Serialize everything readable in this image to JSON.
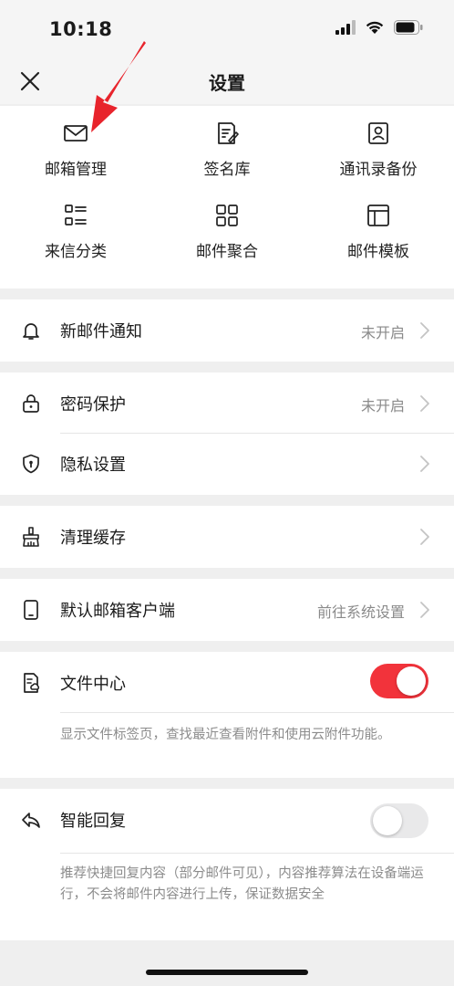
{
  "status_bar": {
    "time": "10:18",
    "icons": [
      "signal-icon",
      "wifi-icon",
      "battery-icon"
    ]
  },
  "nav": {
    "title": "设置",
    "close_icon": "close-icon"
  },
  "grid": {
    "items": [
      {
        "label": "邮箱管理",
        "icon": "mail-icon"
      },
      {
        "label": "签名库",
        "icon": "signature-icon"
      },
      {
        "label": "通讯录备份",
        "icon": "contacts-icon"
      },
      {
        "label": "来信分类",
        "icon": "list-icon"
      },
      {
        "label": "邮件聚合",
        "icon": "grid-icon"
      },
      {
        "label": "邮件模板",
        "icon": "template-icon"
      }
    ]
  },
  "settings": {
    "new_mail_notify": {
      "label": "新邮件通知",
      "value": "未开启",
      "icon": "bell-icon"
    },
    "password_protect": {
      "label": "密码保护",
      "value": "未开启",
      "icon": "lock-icon"
    },
    "privacy": {
      "label": "隐私设置",
      "value": "",
      "icon": "shield-icon"
    },
    "clear_cache": {
      "label": "清理缓存",
      "value": "",
      "icon": "broom-icon"
    },
    "default_client": {
      "label": "默认邮箱客户端",
      "value": "前往系统设置",
      "icon": "phone-icon"
    },
    "file_center": {
      "label": "文件中心",
      "icon": "file-icon",
      "enabled": true,
      "description": "显示文件标签页，查找最近查看附件和使用云附件功能。"
    },
    "smart_reply": {
      "label": "智能回复",
      "icon": "reply-icon",
      "enabled": false,
      "description": "推荐快捷回复内容（部分邮件可见），内容推荐算法在设备端运行，不会将邮件内容进行上传，保证数据安全"
    }
  },
  "colors": {
    "accent": "#f2333b",
    "toggle_off": "#e9e9ea",
    "annotation_arrow": "#e8242c",
    "background": "#efefef",
    "card": "#ffffff"
  }
}
